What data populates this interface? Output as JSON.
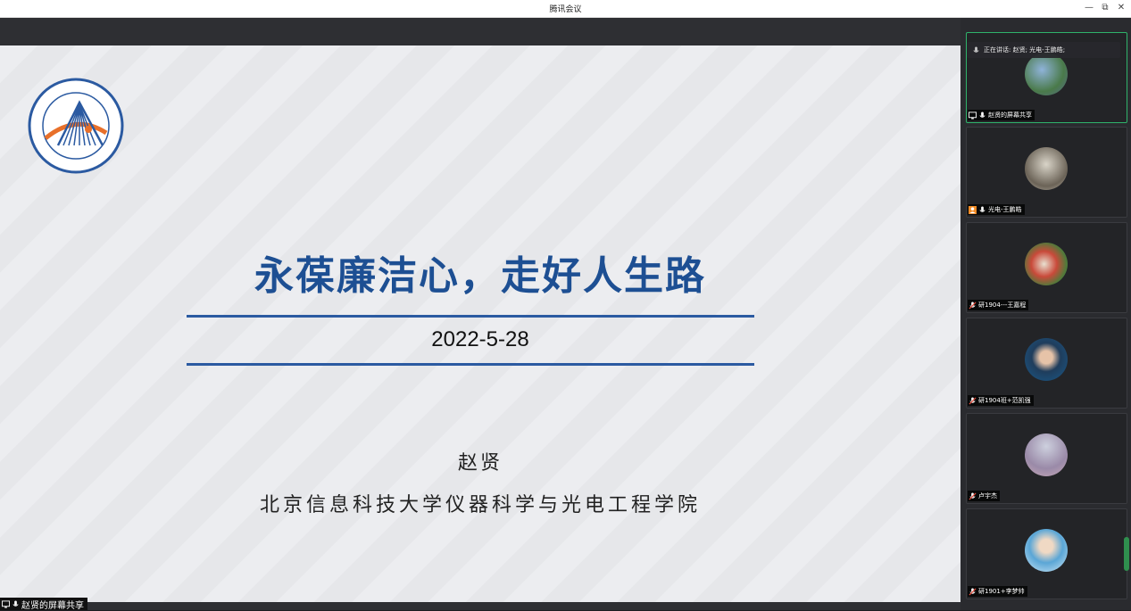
{
  "window": {
    "title": "腾讯会议",
    "minimize": "—",
    "restore": "⧉",
    "close": "✕"
  },
  "slide": {
    "title": "永葆廉洁心，走好人生路",
    "date": "2022-5-28",
    "author": "赵贤",
    "institution": "北京信息科技大学仪器科学与光电工程学院"
  },
  "share_label": "赵贤的屏幕共享",
  "speaking": {
    "text": "正在讲话: 赵贤; 光电-王鹏皓;"
  },
  "participants": [
    {
      "label": "赵贤的屏幕共享",
      "icon": "screen-share-icon",
      "active": true
    },
    {
      "label": "光电-王鹏皓",
      "icon": "person-icon"
    },
    {
      "label": "研1904---王嘉程",
      "icon": "mic-muted-icon"
    },
    {
      "label": "研1904班+范凯强",
      "icon": "mic-muted-icon"
    },
    {
      "label": "卢宇杰",
      "icon": "mic-muted-icon"
    },
    {
      "label": "研1901+李梦帅",
      "icon": "mic-muted-icon"
    }
  ],
  "colors": {
    "accent": "#1d4f93",
    "active_border": "#2fb36b"
  }
}
